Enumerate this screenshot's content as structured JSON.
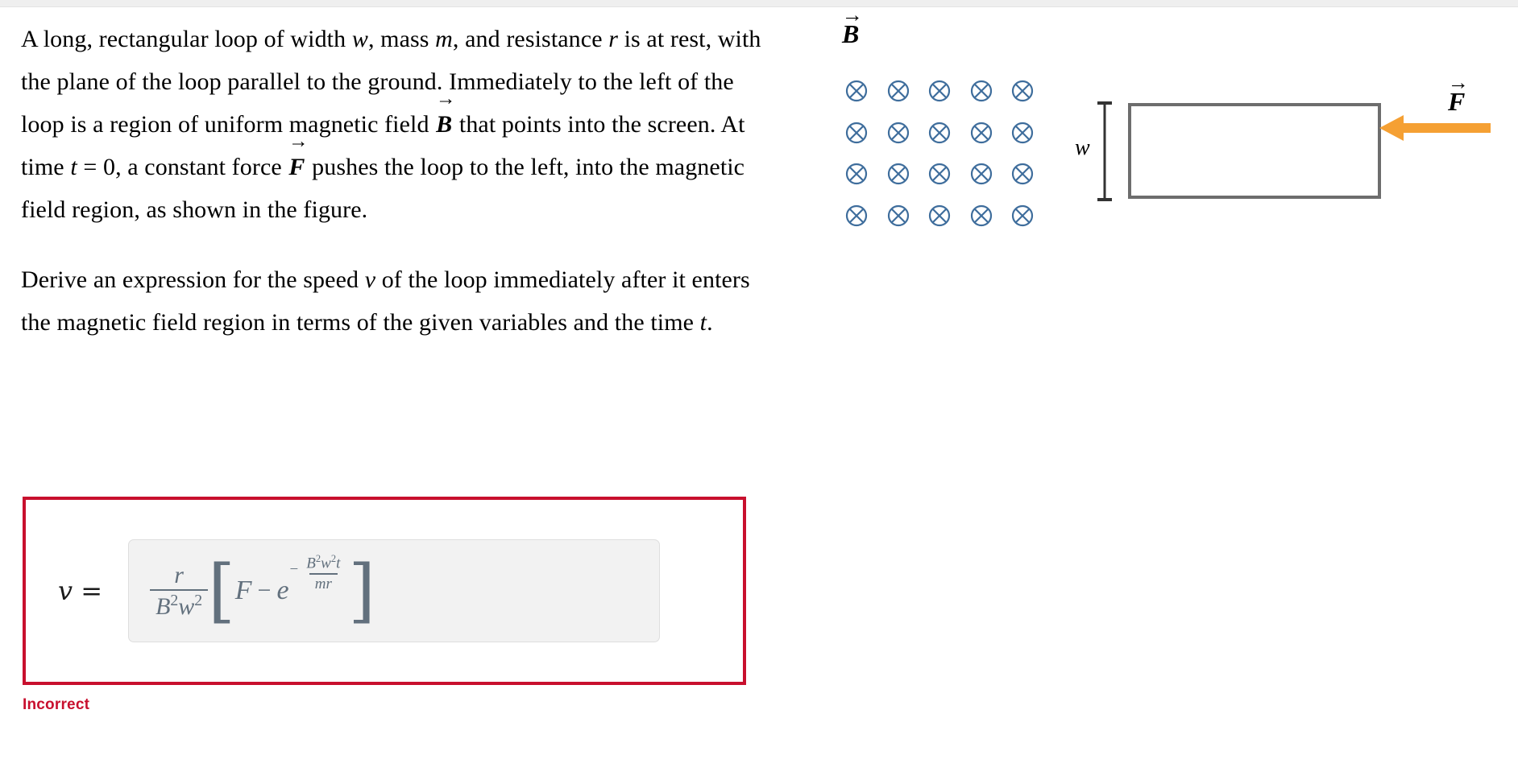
{
  "page": {
    "background_color": "#ffffff",
    "top_strip_color": "#efefef"
  },
  "problem": {
    "paragraph1_parts": {
      "p1a": "A long, rectangular loop of width ",
      "v_w": "w",
      "p1b": ", mass ",
      "v_m": "m",
      "p1c": ", and resistance ",
      "v_r": "r",
      "p1d": " is at rest, with the plane of the loop parallel to the ground. Immediately to the left of the loop is a region of uniform magnetic field ",
      "vec_B": "B",
      "p1e": " that points into the screen. At time ",
      "v_t": "t",
      "p1f": " = 0, a constant force ",
      "vec_F": "F",
      "p1g": " pushes the loop to the left, into the magnetic field region, as shown in the figure."
    },
    "paragraph2_parts": {
      "p2a": "Derive an expression for the speed ",
      "v_v": "v",
      "p2b": " of the loop immediately after it enters the magnetic field region in terms of the given variables and the time ",
      "v_t2": "t",
      "p2c": "."
    },
    "paragraph1_plain": "A long, rectangular loop of width w, mass m, and resistance r is at rest, with the plane of the loop parallel to the ground. Immediately to the left of the loop is a region of uniform magnetic field B that points into the screen. At time t = 0, a constant force F pushes the loop to the left, into the magnetic field region, as shown in the figure.",
    "paragraph2_plain": "Derive an expression for the speed v of the loop immediately after it enters the magnetic field region in terms of the given variables and the time t."
  },
  "figure": {
    "b_field_label": "B",
    "b_field_label_is_vector": true,
    "b_field_direction": "into-screen",
    "cross_color": "#3e6d9c",
    "cross_rows": 4,
    "cross_cols": 5,
    "width_label": "w",
    "force_label": "F",
    "force_label_is_vector": true,
    "force_arrow_direction": "left",
    "force_arrow_color": "#f5a033",
    "loop_border_color": "#6d6d6d"
  },
  "answer": {
    "variable": "v",
    "equals": "=",
    "border_color": "#c8102e",
    "field_background": "#f2f2f2",
    "math_color": "#62707d",
    "expression_latex": "\\frac{r}{B^2 w^2}\\left[F - e^{-\\frac{B^2 w^2 t}{mr}}\\right]",
    "expression_plain": "v = (r / (B^2 w^2)) [ F - e^(-(B^2 w^2 t)/(m r)) ]",
    "parts": {
      "frac_num": "r",
      "frac_den_B": "B",
      "frac_den_Bexp": "2",
      "frac_den_w": "w",
      "frac_den_wexp": "2",
      "bracket_open": "[",
      "bracket_close": "]",
      "term_F": "F",
      "minus": "−",
      "e_base": "e",
      "exp_minus": "−",
      "exp_num_B": "B",
      "exp_num_Bexp": "2",
      "exp_num_w": "w",
      "exp_num_wexp": "2",
      "exp_num_t": "t",
      "exp_den": "mr"
    }
  },
  "status": {
    "text": "Incorrect",
    "color": "#c8102e"
  }
}
